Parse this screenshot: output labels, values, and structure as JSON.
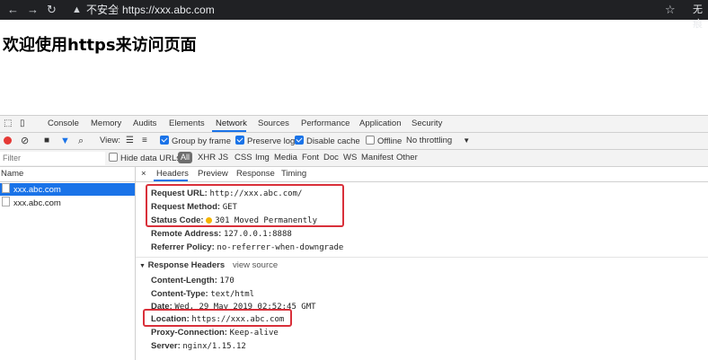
{
  "browser": {
    "security_label": "不安全",
    "url": "https://xxx.abc.com",
    "right_label": "无痕"
  },
  "page": {
    "heading": "欢迎使用https来访问页面"
  },
  "devtools": {
    "tabs": [
      "Console",
      "Memory",
      "Audits",
      "Elements",
      "Network",
      "Sources",
      "Performance",
      "Application",
      "Security"
    ],
    "active_tab": "Network",
    "toolbar": {
      "view_label": "View:",
      "group_by_frame": "Group by frame",
      "preserve_log": "Preserve log",
      "disable_cache": "Disable cache",
      "offline": "Offline",
      "throttling": "No throttling"
    },
    "filter": {
      "placeholder": "Filter",
      "hide_data_urls": "Hide data URLs",
      "types": [
        "All",
        "XHR",
        "JS",
        "CSS",
        "Img",
        "Media",
        "Font",
        "Doc",
        "WS",
        "Manifest",
        "Other"
      ]
    },
    "requests": {
      "header": "Name",
      "rows": [
        "xxx.abc.com",
        "xxx.abc.com"
      ]
    },
    "detail_tabs": [
      "Headers",
      "Preview",
      "Response",
      "Timing"
    ],
    "general": [
      {
        "k": "Request URL:",
        "v": "http://xxx.abc.com/"
      },
      {
        "k": "Request Method:",
        "v": "GET"
      },
      {
        "k": "Status Code:",
        "v": "301 Moved Permanently"
      },
      {
        "k": "Remote Address:",
        "v": "127.0.0.1:8888"
      },
      {
        "k": "Referrer Policy:",
        "v": "no-referrer-when-downgrade"
      }
    ],
    "response_headers": {
      "title": "Response Headers",
      "view_source": "view source",
      "items": [
        {
          "k": "Content-Length:",
          "v": "170"
        },
        {
          "k": "Content-Type:",
          "v": "text/html"
        },
        {
          "k": "Date:",
          "v": "Wed, 29 May 2019 02:52:45 GMT"
        },
        {
          "k": "Location:",
          "v": "https://xxx.abc.com"
        },
        {
          "k": "Proxy-Connection:",
          "v": "Keep-alive"
        },
        {
          "k": "Server:",
          "v": "nginx/1.15.12"
        }
      ]
    }
  },
  "colors": {
    "accent": "#1a73e8",
    "highlight": "#d9303a"
  }
}
